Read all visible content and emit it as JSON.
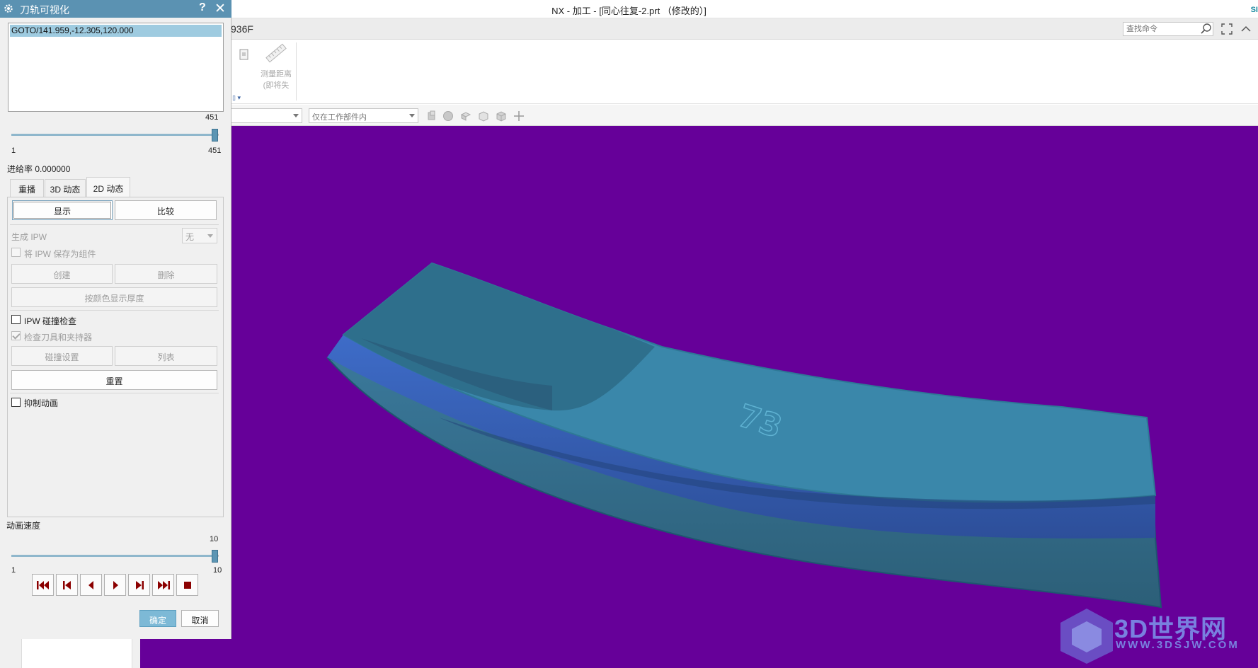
{
  "window": {
    "title": "NX - 加工 - [同心往复-2.prt （修改的）]",
    "brand": "SI"
  },
  "ribbon": {
    "tab_fragment": "936F",
    "search_placeholder": "查找命令",
    "measure_label_line1": "测量距离",
    "measure_label_line2": "(即将失",
    "gallery_marker": "▯ ▾"
  },
  "filter_bar": {
    "combo1_value": "",
    "combo2_value": "仅在工作部件内"
  },
  "dialog": {
    "title": "刀轨可视化",
    "help_glyph": "?",
    "close_glyph": "✕",
    "command_list": [
      "GOTO/141.959,-12.305,120.000"
    ],
    "motion_slider": {
      "min_label": "1",
      "max_label": "451",
      "current_label": "451",
      "fraction": 1.0
    },
    "feed_rate": "进给率 0.000000",
    "tabs": [
      "重播",
      "3D 动态",
      "2D 动态"
    ],
    "active_tab": "2D 动态",
    "display_button": "显示",
    "compare_button": "比较",
    "generate_ipw_label": "生成 IPW",
    "generate_ipw_value": "无",
    "save_ipw_label": "将 IPW 保存为组件",
    "create_button": "创建",
    "delete_button": "删除",
    "thickness_button": "按颜色显示厚度",
    "ipw_collision_label": "IPW 碰撞检查",
    "check_tool_label": "检查刀具和夹持器",
    "collision_settings_button": "碰撞设置",
    "list_button": "列表",
    "reset_button": "重置",
    "suppress_anim_label": "抑制动画",
    "anim_speed_label": "动画速度",
    "speed_slider": {
      "min_label": "1",
      "max_label": "10",
      "current_label": "10",
      "fraction": 1.0
    },
    "ok_button": "确定",
    "cancel_button": "取消"
  },
  "viewport": {
    "background": "#660099",
    "part_engraving": "73"
  },
  "watermark": {
    "text": "3D世界网",
    "url": "WWW.3DSJW.COM"
  },
  "colors": {
    "dialog_title": "#5b92b2",
    "part_face": "#3a86a8",
    "part_side": "#3a5fb8",
    "selection": "#9ecbe0"
  }
}
